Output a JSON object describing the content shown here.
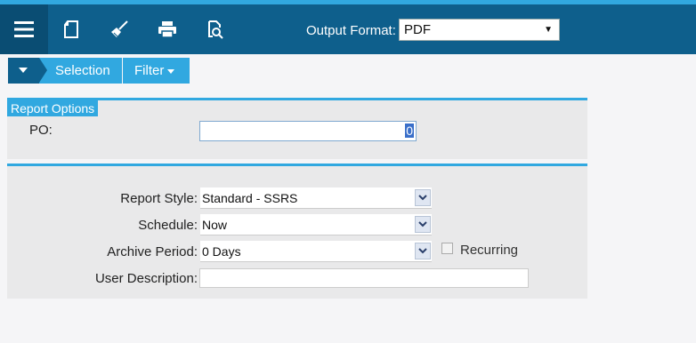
{
  "toolbar": {
    "menu_icon": "hamburger-menu-icon",
    "tools": [
      {
        "icon": "new-document-icon"
      },
      {
        "icon": "clear-broom-icon"
      },
      {
        "icon": "print-icon"
      },
      {
        "icon": "preview-search-icon"
      }
    ],
    "output_format_label": "Output Format:",
    "output_format_value": "PDF"
  },
  "breadcrumb": {
    "selection_label": "Selection",
    "filter_label": "Filter"
  },
  "report_options": {
    "title": "Report Options",
    "po_label": "PO:",
    "po_value": "0"
  },
  "settings": {
    "report_style_label": "Report Style:",
    "report_style_value": "Standard - SSRS",
    "schedule_label": "Schedule:",
    "schedule_value": "Now",
    "archive_label": "Archive Period:",
    "archive_value": "0 Days",
    "recurring_label": "Recurring",
    "recurring_checked": false,
    "user_desc_label": "User Description:",
    "user_desc_value": ""
  },
  "colors": {
    "toolbar_bg": "#0e5f8c",
    "accent": "#31a8e0",
    "panel_bg": "#e9e9ea"
  }
}
